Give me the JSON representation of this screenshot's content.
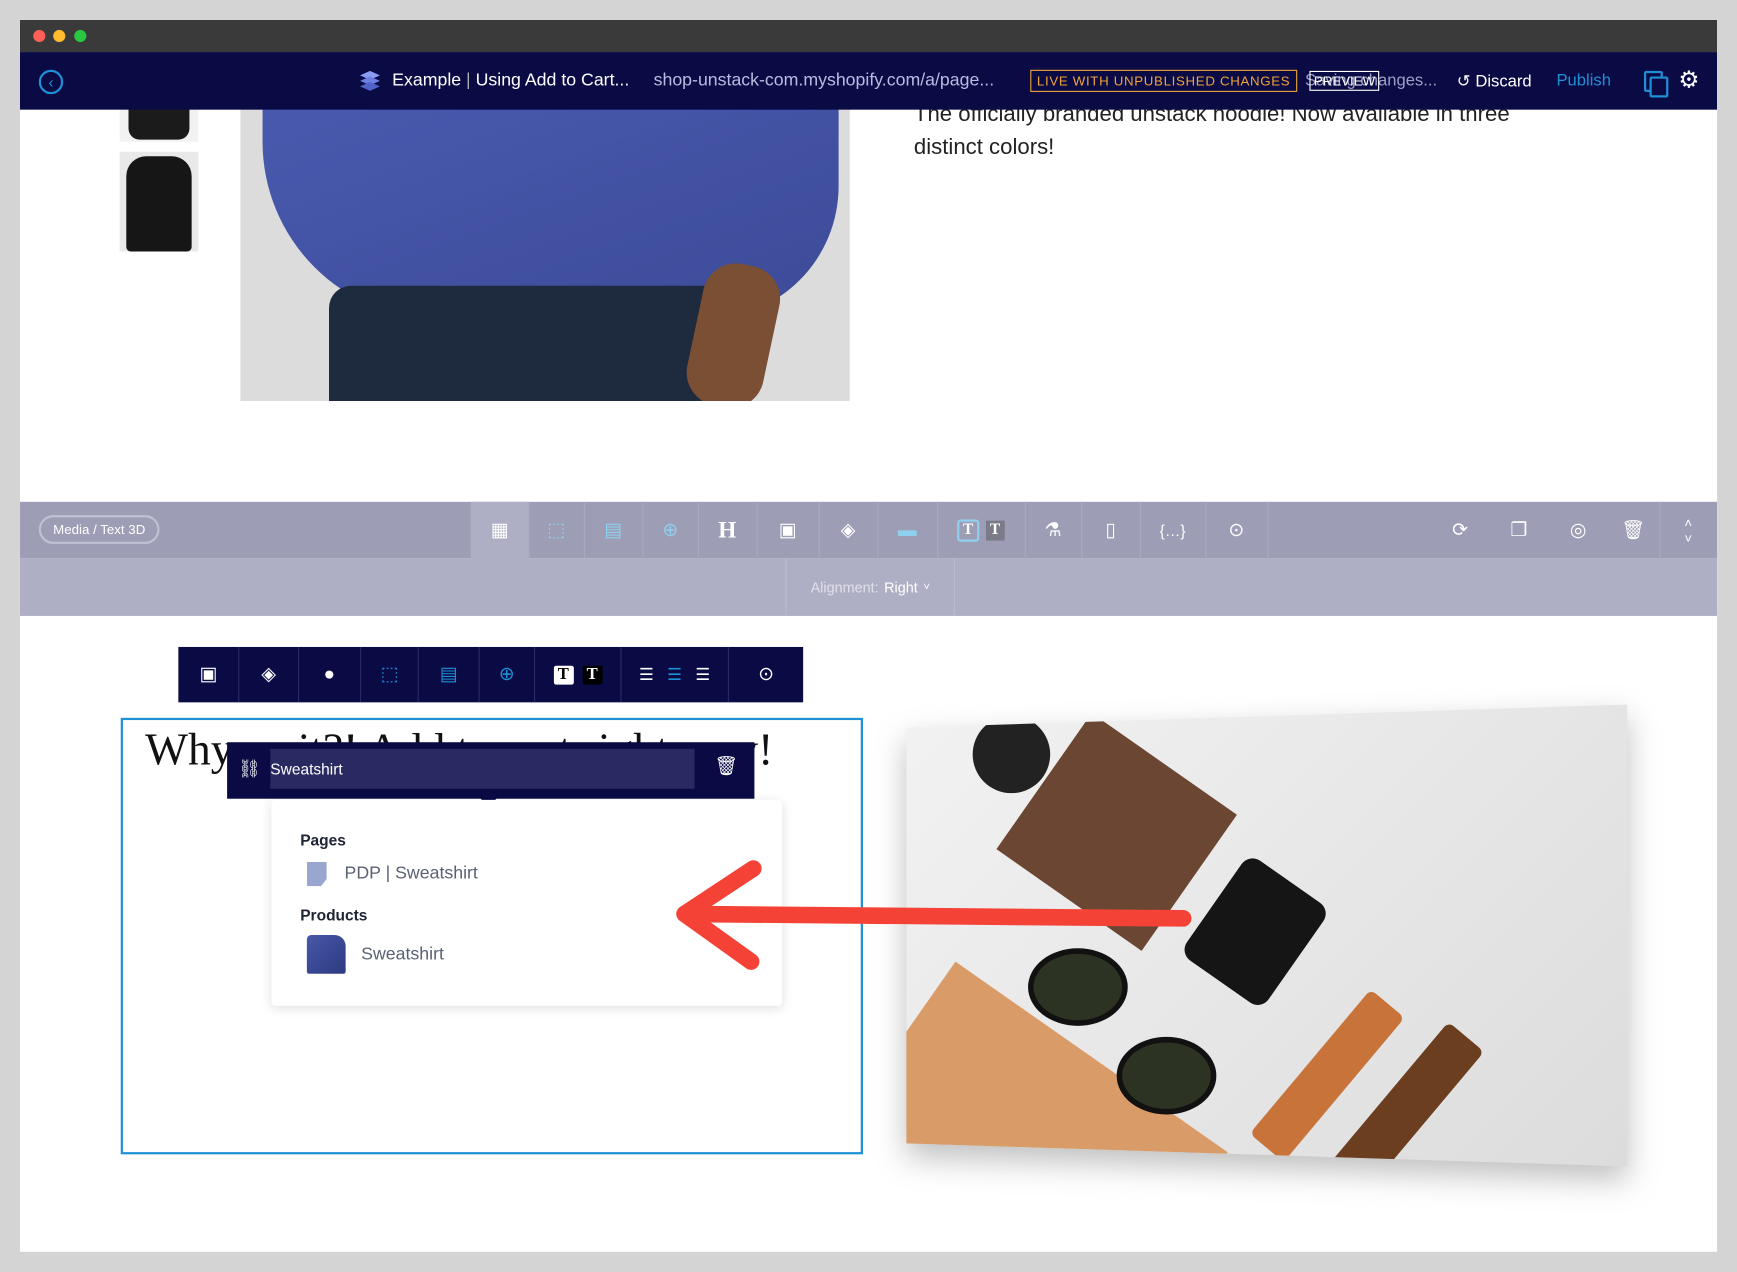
{
  "window": {
    "traffic_lights": [
      "#ff5f57",
      "#febc2e",
      "#28c840"
    ]
  },
  "nav": {
    "back_icon": "chevron-left-circle-icon",
    "logo_icon": "layers-icon",
    "page_name": "Example",
    "page_title": "Using Add to Cart...",
    "url": "shop-unstack-com.myshopify.com/a/page...",
    "status_badge": "LIVE WITH UNPUBLISHED CHANGES",
    "preview_label": "PREVIEW",
    "saving_text": "Saving changes...",
    "discard_label": "Discard",
    "publish_label": "Publish",
    "colors": {
      "nav_bg": "#0a0a45",
      "badge": "#f0a33a",
      "publish": "#1e90d6"
    }
  },
  "product": {
    "description_line1": "The officially branded unstack hoodie! Now available in three",
    "description_line2": "distinct colors!"
  },
  "section_toolbar": {
    "section_label": "Media / Text 3D",
    "alignment_label": "Alignment:",
    "alignment_value": "Right",
    "icons": [
      "layout-icon",
      "resize-icon",
      "width-icon",
      "spacing-icon",
      "heading-icon",
      "image-icon",
      "fill-icon",
      "full-width-icon",
      "text-style-icon",
      "lab-icon",
      "carousel-icon",
      "code-icon",
      "target-icon"
    ],
    "right_icons": [
      "refresh-icon",
      "duplicate-icon",
      "hide-icon",
      "trash-icon",
      "reorder-icon"
    ]
  },
  "block_toolbar": {
    "icons": [
      "image-icon",
      "fill-icon",
      "shadow-icon",
      "resize-icon",
      "width-icon",
      "spacing-icon",
      "text-light-icon",
      "text-dark-icon",
      "align-left-icon",
      "align-center-icon",
      "align-right-icon",
      "target-icon"
    ]
  },
  "content": {
    "heading": "Why wait?! Add to cart right now!",
    "link_input_value": "Sweatshirt",
    "popup": {
      "pages_header": "Pages",
      "pages": [
        {
          "label": "PDP | Sweatshirt"
        }
      ],
      "products_header": "Products",
      "products": [
        {
          "label": "Sweatshirt"
        }
      ]
    },
    "annotation_color": "#f44336"
  }
}
